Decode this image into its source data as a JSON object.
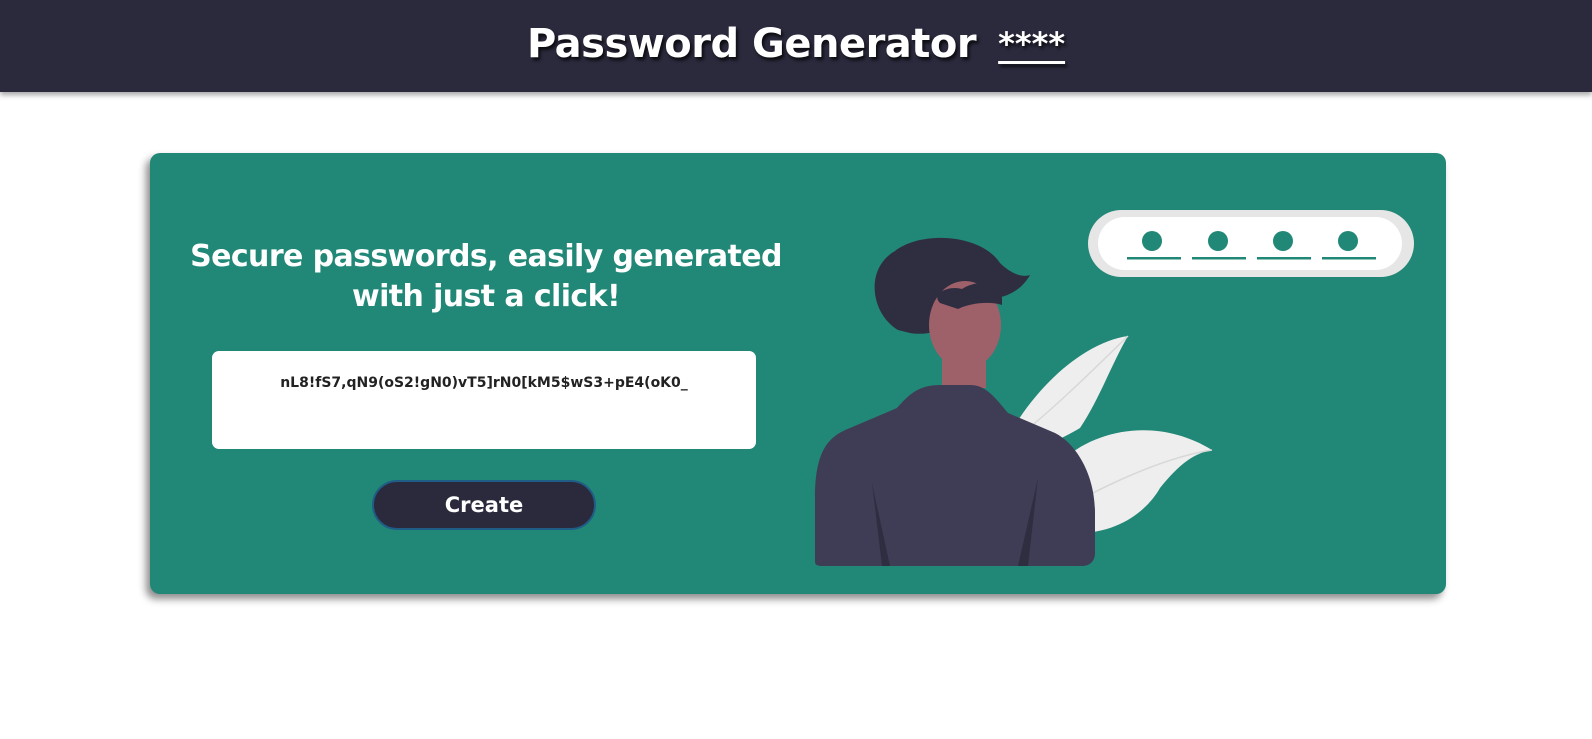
{
  "header": {
    "title": "Password Generator",
    "stars": "****"
  },
  "main": {
    "headline": "Secure passwords, easily generated with just a click!",
    "password_value": "nL8!fS7,qN9(oS2!gN0)vT5]rN0[kM5$wS3+pE4(oK0_",
    "create_label": "Create"
  },
  "colors": {
    "header_bg": "#2b2a3d",
    "card_bg": "#218776",
    "button_bg": "#2b2a3d"
  }
}
